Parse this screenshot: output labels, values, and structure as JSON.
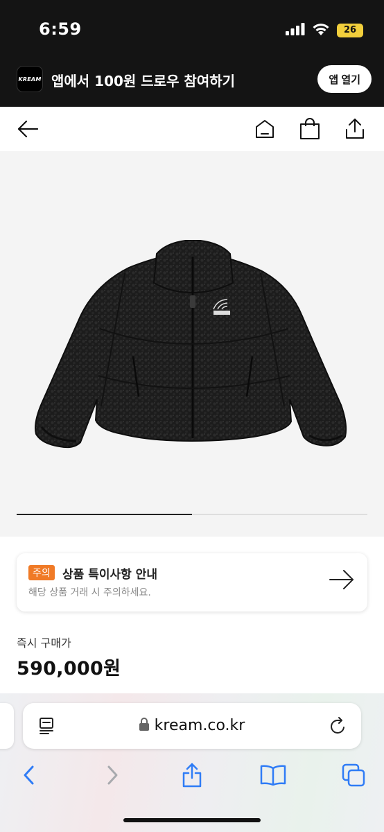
{
  "status_bar": {
    "time": "6:59",
    "battery_level": "26",
    "icons": [
      "signal-icon",
      "wifi-icon",
      "battery-icon"
    ]
  },
  "app_banner": {
    "logo_text": "KREAM",
    "text": "앱에서 100원 드로우 참여하기",
    "open_button": "앱 열기"
  },
  "nav": {
    "icons": [
      "back-arrow-icon",
      "home-icon",
      "shopping-bag-icon",
      "share-icon"
    ]
  },
  "product": {
    "image_subject": "black fleece jacket",
    "brand_mark": "THE NORTH FACE",
    "carousel_progress": 0.5
  },
  "notice": {
    "badge": "주의",
    "title": "상품 특이사항 안내",
    "subtitle": "해당 상품 거래 시 주의하세요.",
    "icon": "arrow-right-icon"
  },
  "price": {
    "label": "즉시 구매가",
    "value": "590,000원"
  },
  "browser": {
    "url": "kream.co.kr",
    "icons": [
      "reader-icon",
      "lock-icon",
      "reload-icon",
      "back-icon",
      "forward-icon",
      "share-icon",
      "bookmarks-icon",
      "tabs-icon"
    ]
  },
  "colors": {
    "accent": "#f07a26",
    "dark_header": "#141414",
    "battery": "#f2cf3c",
    "safari_blue": "#2f7cf6"
  }
}
